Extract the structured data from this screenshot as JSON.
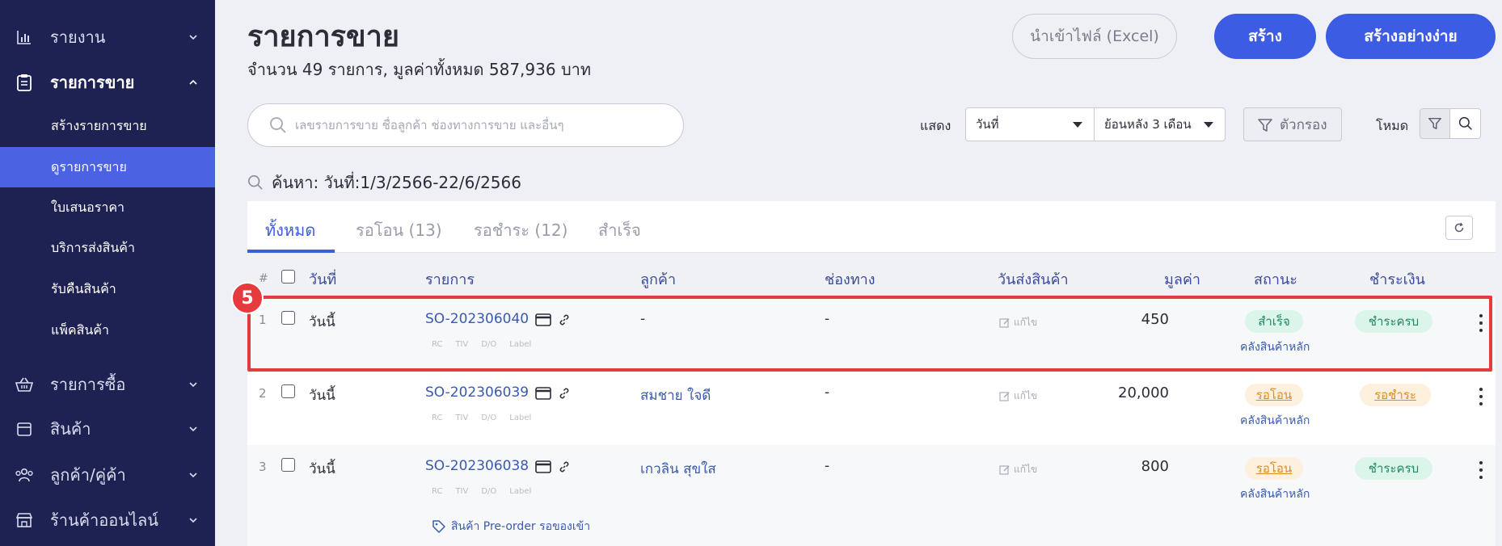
{
  "sidebar": {
    "items": [
      {
        "label": "รายงาน",
        "icon": "bar-chart-icon"
      },
      {
        "label": "รายการขาย",
        "icon": "clipboard-icon"
      },
      {
        "label": "รายการซื้อ",
        "icon": "basket-icon"
      },
      {
        "label": "สินค้า",
        "icon": "box-icon"
      },
      {
        "label": "ลูกค้า/คู่ค้า",
        "icon": "people-icon"
      },
      {
        "label": "ร้านค้าออนไลน์",
        "icon": "store-icon"
      }
    ],
    "subitems": [
      {
        "label": "สร้างรายการขาย"
      },
      {
        "label": "ดูรายการขาย"
      },
      {
        "label": "ใบเสนอราคา"
      },
      {
        "label": "บริการส่งสินค้า"
      },
      {
        "label": "รับคืนสินค้า"
      },
      {
        "label": "แพ็คสินค้า"
      }
    ]
  },
  "header": {
    "title": "รายการขาย",
    "subtitle": "จำนวน 49 รายการ, มูลค่าทั้งหมด 587,936 บาท",
    "import_label": "นำเข้าไฟล์ (Excel)",
    "create_label": "สร้าง",
    "create_simple_label": "สร้างอย่างง่าย"
  },
  "search": {
    "placeholder": "เลขรายการขาย ชื่อลูกค้า ช่องทางการขาย และอื่นๆ",
    "value": ""
  },
  "filters": {
    "show_label": "แสดง",
    "date_type": "วันที่",
    "range": "ย้อนหลัง 3 เดือน",
    "filter_label": "ตัวกรอง",
    "mode_label": "โหมด"
  },
  "query": "ค้นหา: วันที่:1/3/2566-22/6/2566",
  "tabs": [
    {
      "label": "ทั้งหมด"
    },
    {
      "label": "รอโอน (13)"
    },
    {
      "label": "รอชำระ (12)"
    },
    {
      "label": "สำเร็จ"
    }
  ],
  "table": {
    "headers": {
      "hash": "#",
      "date": "วันที่",
      "item": "รายการ",
      "customer": "ลูกค้า",
      "channel": "ช่องทาง",
      "ship_date": "วันส่งสินค้า",
      "value": "มูลค่า",
      "status": "สถานะ",
      "payment": "ชำระเงิน"
    },
    "tag_labels": [
      "RC",
      "TIV",
      "D/O",
      "Label"
    ],
    "edit_label": "แก้ไข",
    "rows": [
      {
        "num": "1",
        "date": "วันนี้",
        "so": "SO-202306040",
        "customer": "-",
        "channel": "-",
        "value": "450",
        "status": "สำเร็จ",
        "warehouse": "คลังสินค้าหลัก",
        "payment": "ชำระครบ"
      },
      {
        "num": "2",
        "date": "วันนี้",
        "so": "SO-202306039",
        "customer": "สมชาย ใจดี",
        "channel": "-",
        "value": "20,000",
        "status": "รอโอน",
        "warehouse": "คลังสินค้าหลัก",
        "payment": "รอชำระ"
      },
      {
        "num": "3",
        "date": "วันนี้",
        "so": "SO-202306038",
        "customer": "เกวลิน สุขใส",
        "channel": "-",
        "value": "800",
        "status": "รอโอน",
        "warehouse": "คลังสินค้าหลัก",
        "payment": "ชำระครบ",
        "note": "สินค้า Pre-order รอของเข้า"
      }
    ]
  },
  "annotation": {
    "step": "5"
  },
  "colors": {
    "accent": "#3d5ce4",
    "sidebar": "#1e2253",
    "highlight": "#e53b3f"
  }
}
